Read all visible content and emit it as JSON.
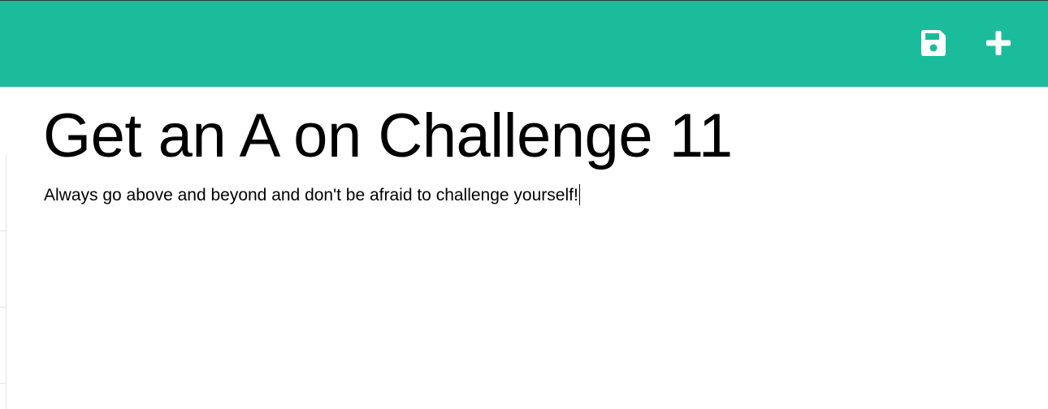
{
  "toolbar": {
    "save_icon": "save-icon",
    "add_icon": "plus-icon",
    "background_color": "#1abc9c",
    "icon_color": "#ffffff"
  },
  "note": {
    "title": "Get an A on Challenge 11",
    "body": "Always go above and beyond and don't be afraid to challenge yourself!"
  }
}
